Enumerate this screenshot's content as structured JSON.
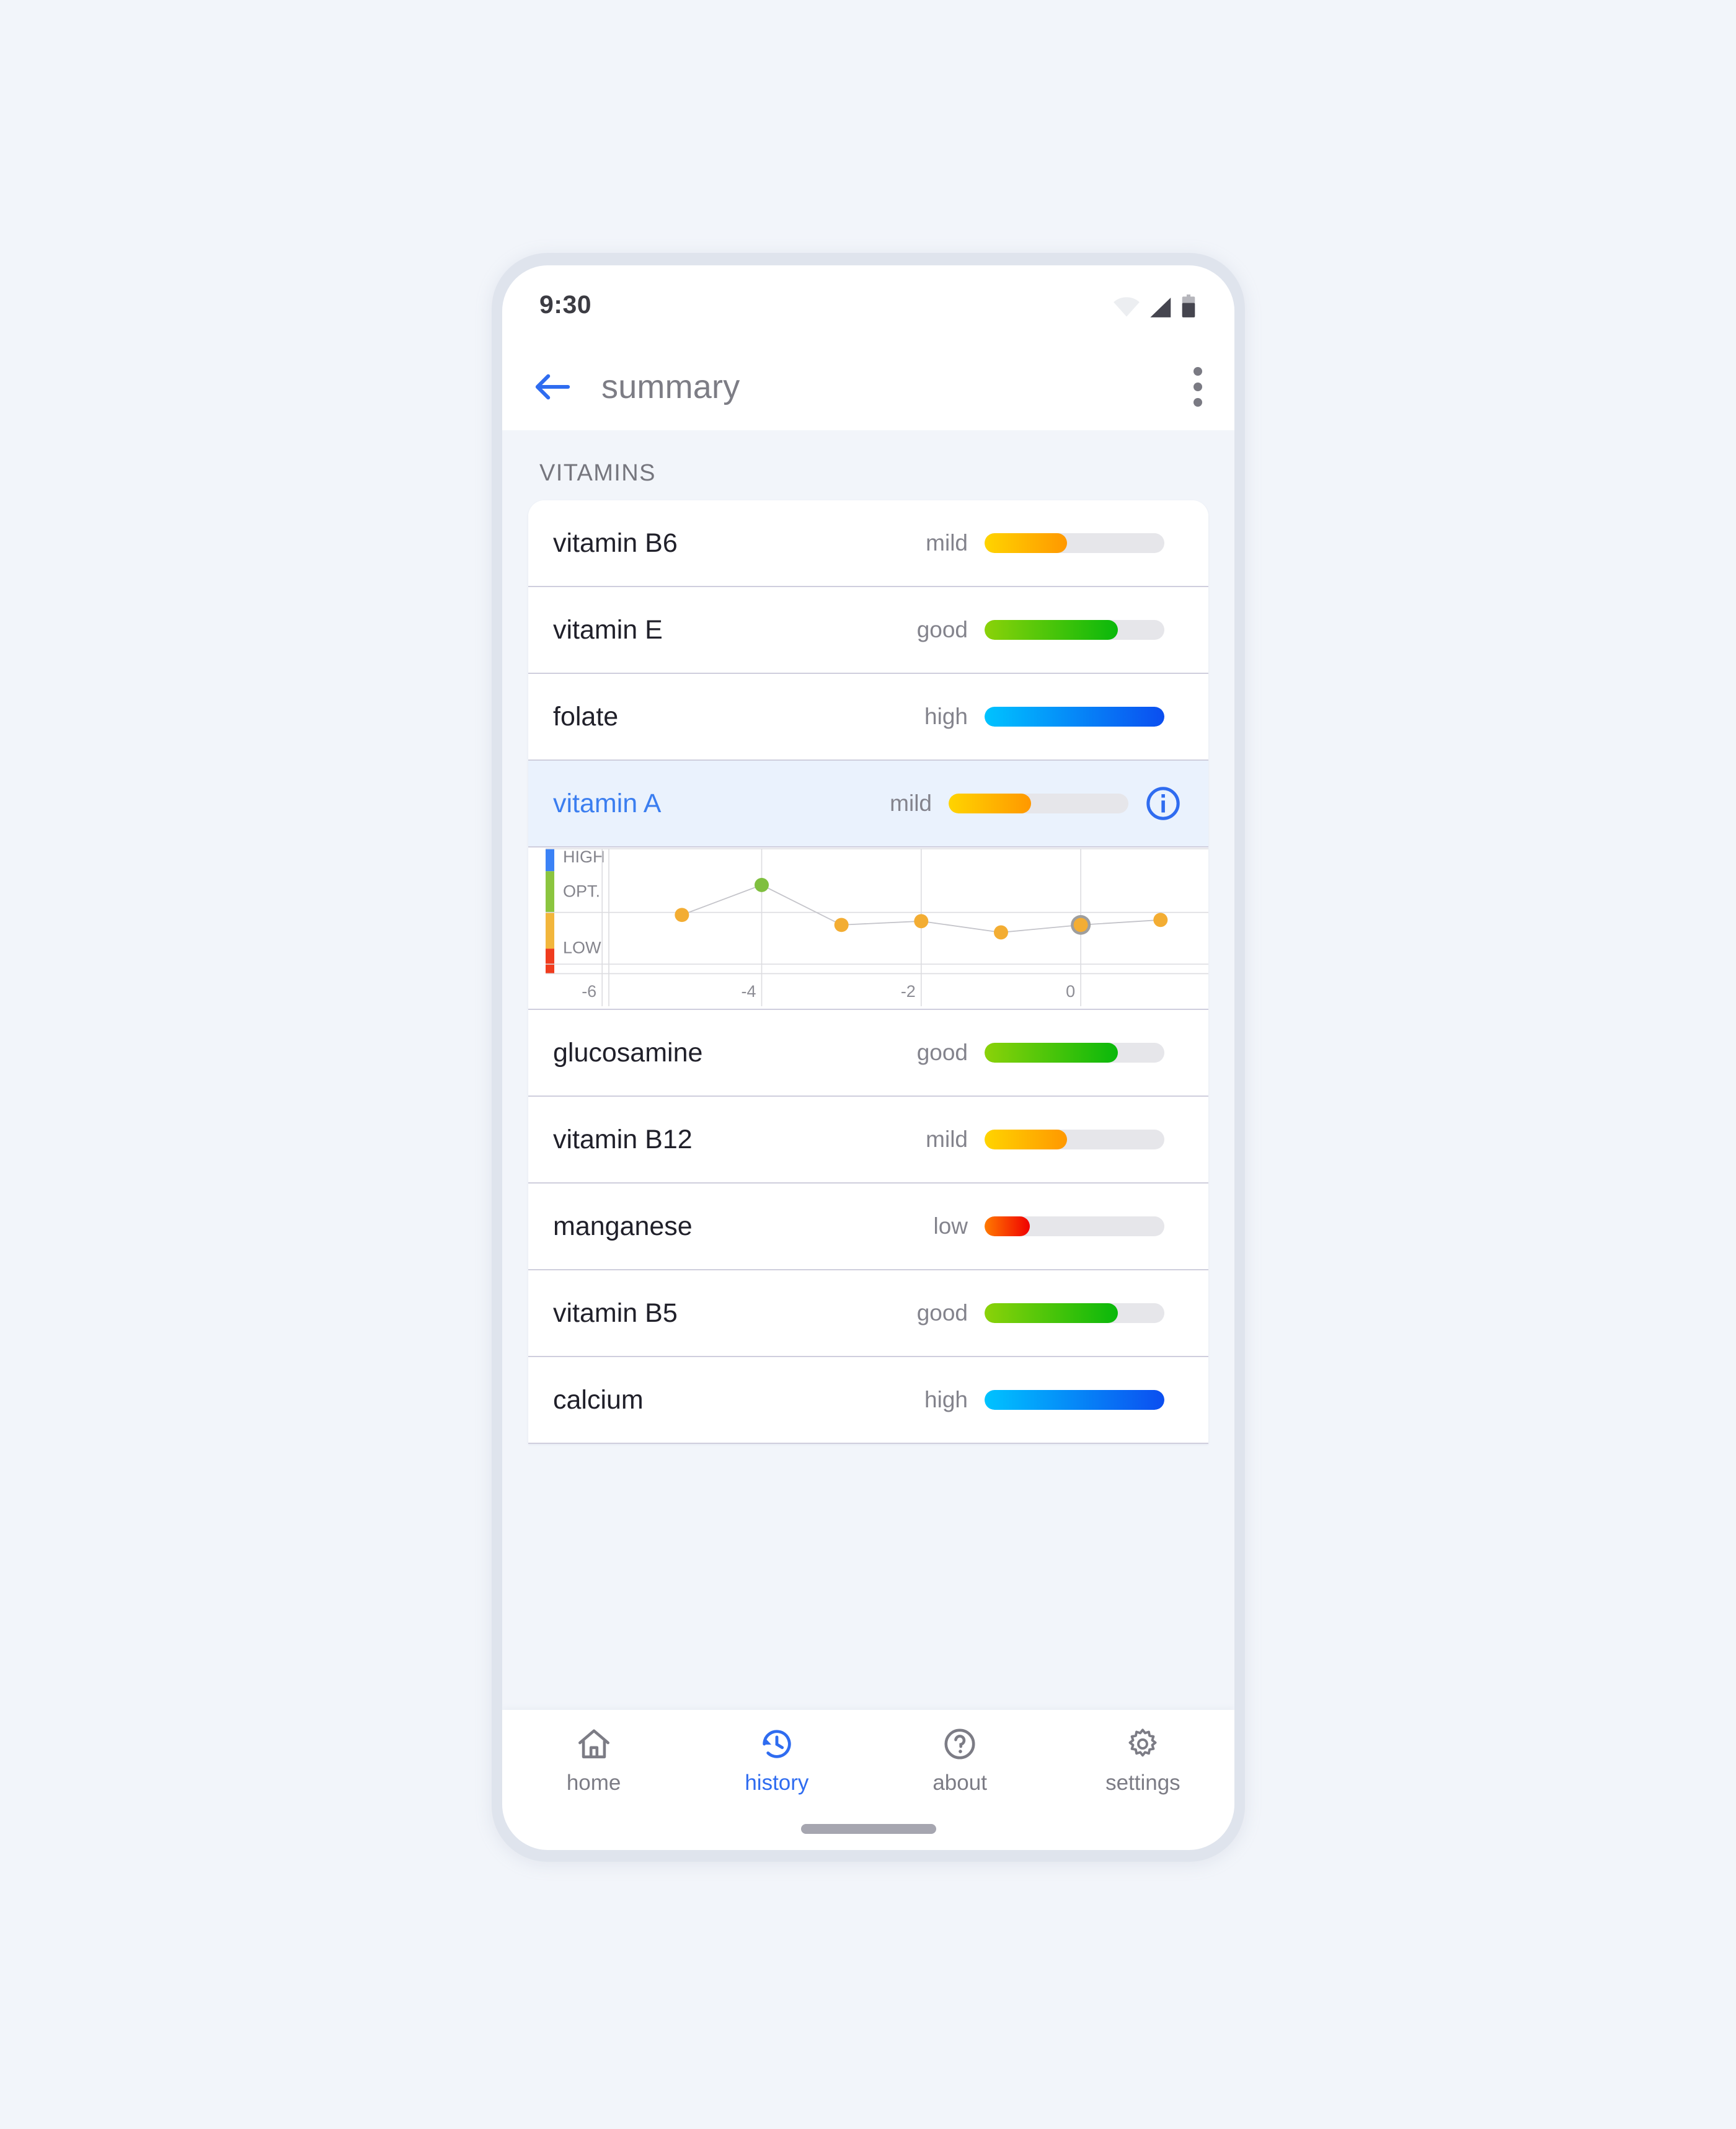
{
  "status_bar": {
    "time": "9:30",
    "icons": [
      "wifi-icon",
      "signal-icon",
      "battery-icon"
    ]
  },
  "app_bar": {
    "back_label": "back-arrow-icon",
    "title": "summary",
    "overflow_label": "more-options-icon"
  },
  "section": {
    "label": "VITAMINS"
  },
  "colors": {
    "accent_blue": "#2f6cf0",
    "selected_row_bg": "#eaf2fd",
    "page_bg": "#f2f5fa",
    "bezel": "#dfe4ed",
    "divider": "#cfcedd",
    "track": "#e6e6ea",
    "status_text": "#83838c",
    "mild_from": "#ffd400",
    "mild_to": "#ff9800",
    "good_from": "#8bd209",
    "good_to": "#09b80b",
    "high_from": "#00c3ff",
    "high_to": "#0b4ef0",
    "low_from": "#ff7a00",
    "low_to": "#f00000",
    "point_orange": "#f3ad33",
    "point_green": "#7fbf3f",
    "point_ring": "#9e9e9e"
  },
  "rows": [
    {
      "name": "vitamin B6",
      "status": "mild",
      "level": "mild",
      "pct": 46,
      "selected": false,
      "has_info": false
    },
    {
      "name": "vitamin E",
      "status": "good",
      "level": "good",
      "pct": 74,
      "selected": false,
      "has_info": false
    },
    {
      "name": "folate",
      "status": "high",
      "level": "high",
      "pct": 100,
      "selected": false,
      "has_info": false
    },
    {
      "name": "vitamin A",
      "status": "mild",
      "level": "mild",
      "pct": 46,
      "selected": true,
      "has_info": true
    },
    {
      "name": "glucosamine",
      "status": "good",
      "level": "good",
      "pct": 74,
      "selected": false,
      "has_info": false
    },
    {
      "name": "vitamin B12",
      "status": "mild",
      "level": "mild",
      "pct": 46,
      "selected": false,
      "has_info": false
    },
    {
      "name": "manganese",
      "status": "low",
      "level": "low",
      "pct": 25,
      "selected": false,
      "has_info": false
    },
    {
      "name": "vitamin B5",
      "status": "good",
      "level": "good",
      "pct": 74,
      "selected": false,
      "has_info": false
    },
    {
      "name": "calcium",
      "status": "high",
      "level": "high",
      "pct": 100,
      "selected": false,
      "has_info": false
    }
  ],
  "chart_data": {
    "type": "line",
    "title": "",
    "xlabel": "",
    "ylabel": "",
    "x": [
      -5,
      -4,
      -3,
      -2,
      -1,
      0,
      1
    ],
    "values": [
      2.35,
      3.55,
      1.95,
      2.1,
      1.65,
      1.95,
      2.15
    ],
    "point_colors": [
      "#f3ad33",
      "#7fbf3f",
      "#f3ad33",
      "#f3ad33",
      "#f3ad33",
      "#f3ad33",
      "#f3ad33"
    ],
    "highlighted_index": 5,
    "xticks": [
      -6,
      -4,
      -2,
      0
    ],
    "xtick_labels": [
      "-6",
      "-4",
      "-2",
      "0"
    ],
    "xlim": [
      -6.6,
      1.6
    ],
    "ylim": [
      0,
      5
    ],
    "grid": true,
    "y_zone_labels": [
      "HIGH",
      "OPT.",
      "LOW"
    ],
    "y_zone_bands": [
      {
        "label": "HIGH",
        "color": "#3b82f6",
        "from": 4.1,
        "to": 5.0
      },
      {
        "label": "OPT.",
        "color": "#8bc53f",
        "from": 2.45,
        "to": 4.1
      },
      {
        "label": "",
        "color": "#f2b63c",
        "from": 1.0,
        "to": 2.45
      },
      {
        "label": "LOW",
        "color": "#f03c1e",
        "from": 0.0,
        "to": 1.0
      }
    ],
    "hgridlines": [
      2.45,
      0.38
    ]
  },
  "bottom_nav": {
    "items": [
      {
        "label": "home",
        "icon": "home-icon",
        "active": false
      },
      {
        "label": "history",
        "icon": "history-icon",
        "active": true
      },
      {
        "label": "about",
        "icon": "help-icon",
        "active": false
      },
      {
        "label": "settings",
        "icon": "gear-icon",
        "active": false
      }
    ]
  }
}
